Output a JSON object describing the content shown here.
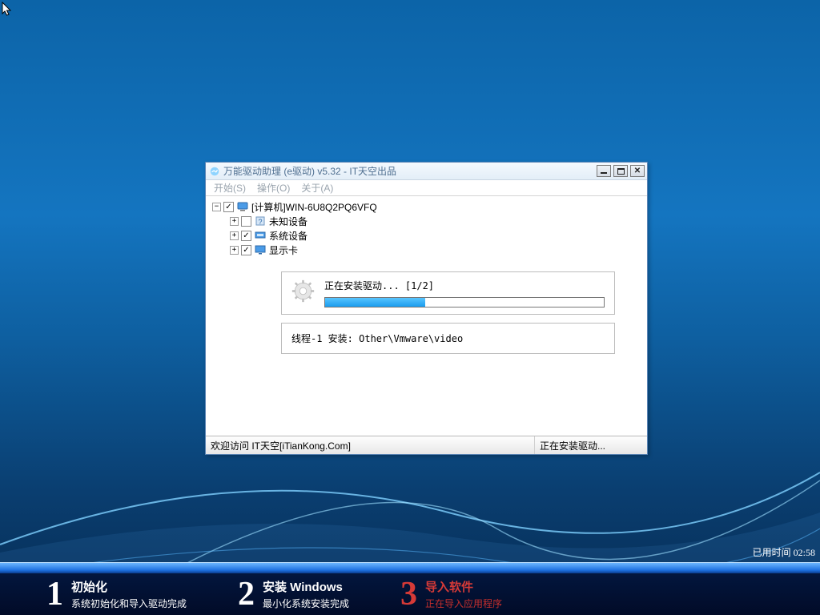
{
  "window": {
    "title": "万能驱动助理 (e驱动) v5.32 - IT天空出品",
    "menu": {
      "start": "开始(S)",
      "operate": "操作(O)",
      "about": "关于(A)"
    },
    "tree": {
      "root": {
        "label": "[计算机]WIN-6U8Q2PQ6VFQ",
        "checked": true,
        "expander": "−"
      },
      "children": [
        {
          "label": "未知设备",
          "checked": false,
          "expander": "+"
        },
        {
          "label": "系统设备",
          "checked": true,
          "expander": "+"
        },
        {
          "label": "显示卡",
          "checked": true,
          "expander": "+"
        }
      ]
    },
    "progress": {
      "label": "正在安装驱动... [1/2]",
      "percent": 36,
      "thread_line": "线程-1 安装:  Other\\Vmware\\video"
    },
    "status": {
      "left": "欢迎访问 IT天空[iTianKong.Com]",
      "right": "正在安装驱动..."
    }
  },
  "footer": {
    "elapsed": "已用时间 02:58",
    "steps": [
      {
        "num": "1",
        "title": "初始化",
        "subtitle": "系统初始化和导入驱动完成"
      },
      {
        "num": "2",
        "title": "安装 Windows",
        "subtitle": "最小化系统安装完成"
      },
      {
        "num": "3",
        "title": "导入软件",
        "subtitle": "正在导入应用程序"
      }
    ]
  }
}
